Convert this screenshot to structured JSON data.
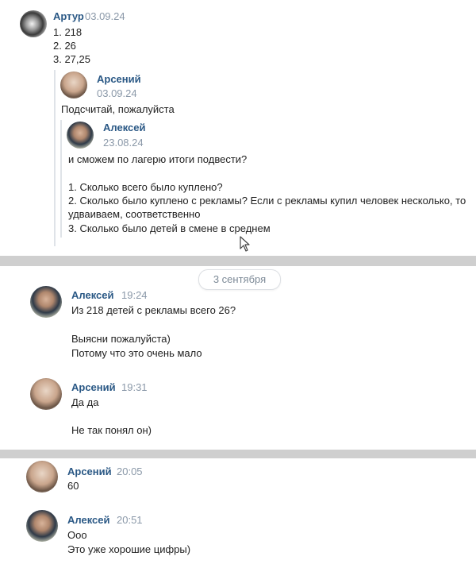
{
  "top_message": {
    "author": "Артур",
    "date": "03.09.24",
    "lines": [
      "1. 218",
      "2. 26",
      "3. 27,25"
    ],
    "forward1": {
      "author": "Арсений",
      "date": "03.09.24",
      "text": "Подсчитай, пожалуйста",
      "forward2": {
        "author": "Алексей",
        "date": "23.08.24",
        "lines": [
          "и сможем по лагерю итоги подвести?",
          "",
          "1. Сколько всего было куплено?",
          "2. Сколько было куплено с рекламы? Если с рекламы купил человек несколько, то",
          "удваиваем, соответственно",
          "3. Сколько было детей в смене в среднем"
        ]
      }
    }
  },
  "date_divider": "3 сентября",
  "messages": [
    {
      "author": "Алексей",
      "time": "19:24",
      "lines": [
        "Из 218 детей с рекламы всего 26?",
        "",
        "Выясни пожалуйста)",
        "Потому что это очень мало"
      ]
    },
    {
      "author": "Арсений",
      "time": "19:31",
      "lines": [
        "Да да",
        "",
        "Не так понял он)"
      ]
    },
    {
      "author": "Арсений",
      "time": "20:05",
      "lines": [
        "60"
      ]
    },
    {
      "author": "Алексей",
      "time": "20:51",
      "lines": [
        "Ооо",
        "Это уже хорошие цифры)"
      ]
    }
  ],
  "colors": {
    "name": "#2a5885",
    "time": "#8a98a8",
    "separator": "#cfcfcf"
  }
}
